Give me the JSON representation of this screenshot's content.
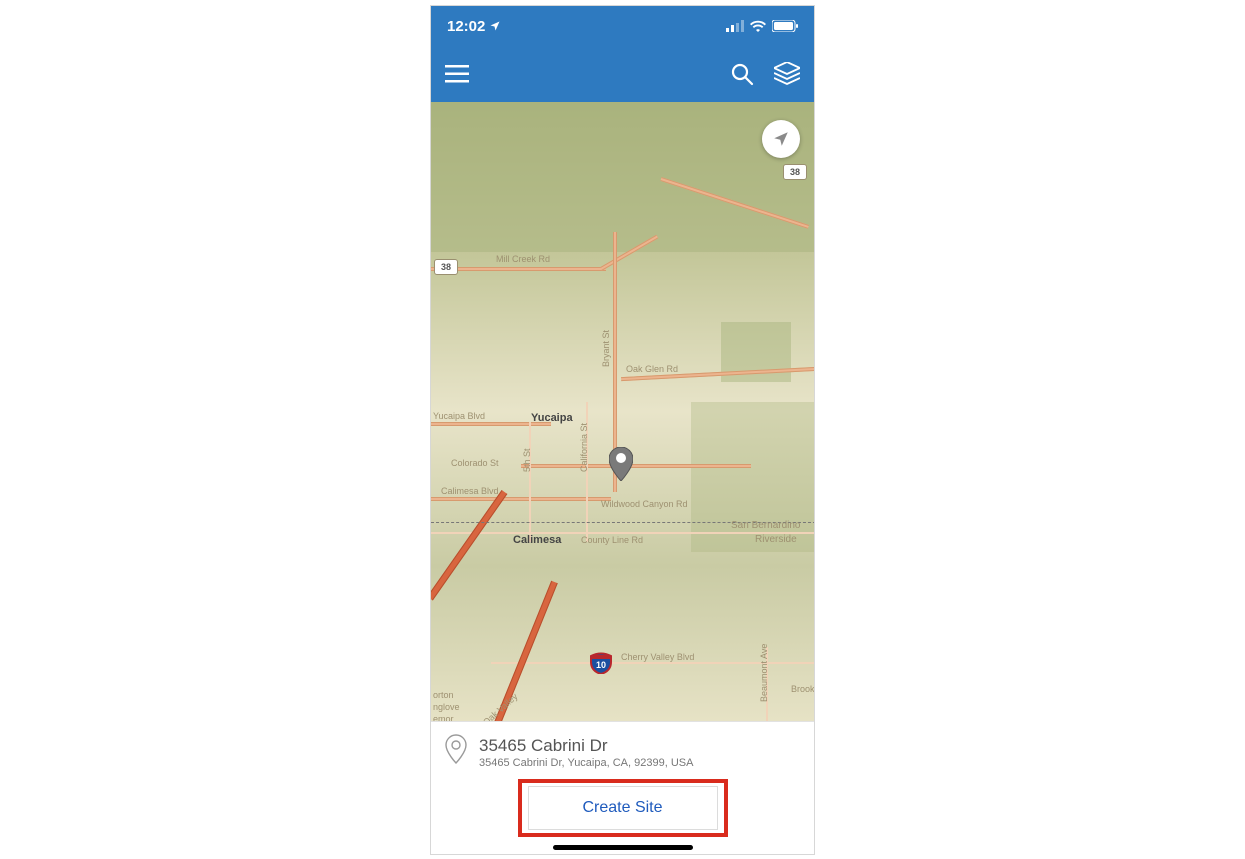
{
  "status": {
    "time": "12:02",
    "location_arrow": true
  },
  "nav": {},
  "map": {
    "shields": {
      "rt38_a": "38",
      "rt38_b": "38",
      "interstate": "10"
    },
    "labels": {
      "mill_creek": "Mill Creek Rd",
      "oak_glen": "Oak Glen Rd",
      "bryant": "Bryant St",
      "yucaipa_blvd": "Yucaipa Blvd",
      "california": "California St",
      "fifth": "5th St",
      "colorado": "Colorado St",
      "calimesa_blvd": "Calimesa Blvd",
      "wildwood": "Wildwood Canyon Rd",
      "county_line": "County Line Rd",
      "cherry_valley": "Cherry Valley Blvd",
      "beaumont": "Beaumont Ave",
      "oak_valley": "Oak Valley",
      "brook": "Brook",
      "orton": "orton",
      "nglove": "nglove",
      "emor": "emor"
    },
    "cities": {
      "yucaipa": "Yucaipa",
      "calimesa": "Calimesa"
    },
    "regions": {
      "sb": "San Bernardino",
      "riv": "Riverside"
    }
  },
  "card": {
    "title": "35465 Cabrini Dr",
    "subtitle": "35465 Cabrini Dr, Yucaipa, CA, 92399, USA",
    "button": "Create Site"
  }
}
